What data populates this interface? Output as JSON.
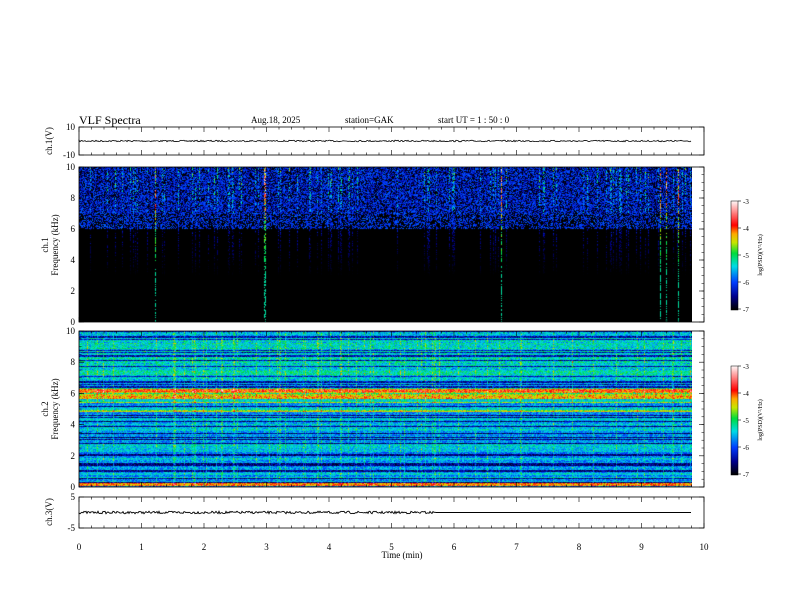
{
  "header": {
    "title": "VLF  Spectra",
    "date": "Aug.18, 2025",
    "station": "station=GAK",
    "start": "start  UT  =   1  : 50 : 0"
  },
  "chart_data": [
    {
      "type": "line",
      "ylabel": "ch.1(V)",
      "ylim": [
        -10,
        10
      ],
      "yticks": [
        "10",
        "-10"
      ],
      "xlim": [
        0,
        10
      ],
      "trace_level": 0
    },
    {
      "type": "heatmap",
      "ylabel": "ch.1\nFrequency  (kHz)",
      "ylabel_lines": [
        "ch.1",
        "Frequency  (kHz)"
      ],
      "ylim": [
        0,
        10
      ],
      "yticks": [
        "0",
        "2",
        "4",
        "6",
        "8",
        "10"
      ],
      "xlim": [
        0,
        10
      ],
      "data_end_min": 9.8,
      "colorbar": {
        "label": "log(PSD)(V²/Hz)",
        "ticks": [
          "-3",
          "-4",
          "-5",
          "-6",
          "-7"
        ],
        "range": [
          -7,
          -3
        ],
        "colormap": "black-blue-cyan-green-yellow-red-white"
      }
    },
    {
      "type": "heatmap",
      "ylabel_lines": [
        "ch.2",
        "Frequency  (kHz)"
      ],
      "ylim": [
        0,
        10
      ],
      "yticks": [
        "0",
        "2",
        "4",
        "6",
        "8",
        "10"
      ],
      "xlim": [
        0,
        10
      ],
      "data_end_min": 9.8,
      "colorbar": {
        "label": "log(PSD)(V²/Hz)",
        "ticks": [
          "-3",
          "-4",
          "-5",
          "-6",
          "-7"
        ],
        "range": [
          -7,
          -3
        ]
      }
    },
    {
      "type": "line",
      "ylabel": "ch.3(V)",
      "ylim": [
        -5,
        5
      ],
      "yticks": [
        "5",
        "-5"
      ],
      "xlim": [
        0,
        10
      ],
      "trace_level": 0,
      "noisy_until_min": 5.7,
      "xlabel": "Time  (min)",
      "xticks": [
        "0",
        "1",
        "2",
        "3",
        "4",
        "5",
        "6",
        "7",
        "8",
        "9",
        "10"
      ]
    }
  ]
}
